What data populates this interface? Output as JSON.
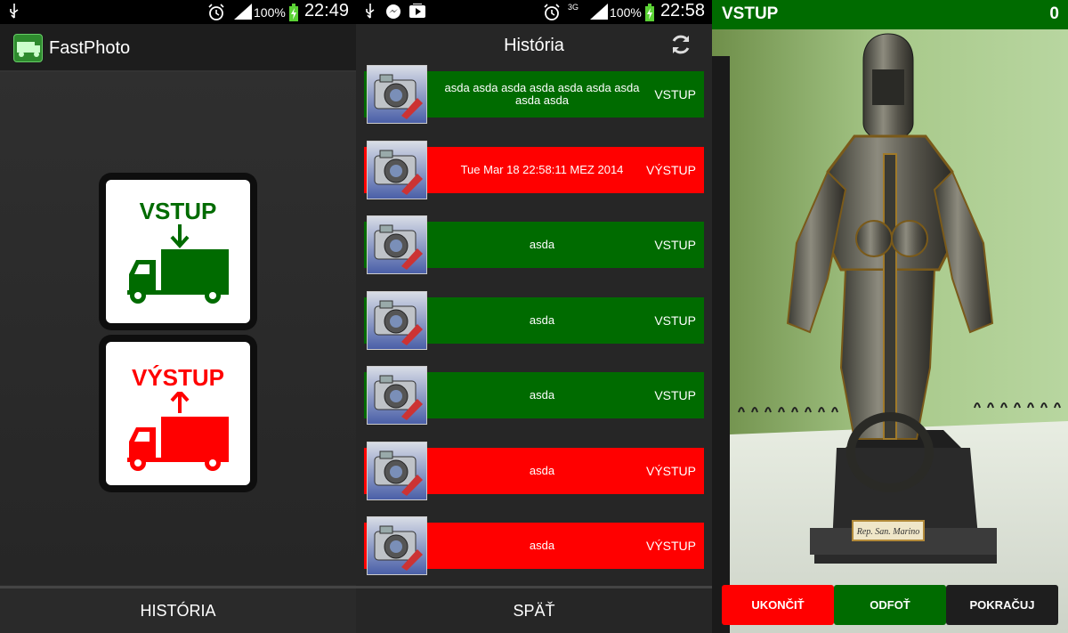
{
  "screen1": {
    "status": {
      "battery_pct": "100%",
      "time": "22:49"
    },
    "app_title": "FastPhoto",
    "vstup_label": "VSTUP",
    "vystup_label": "VÝSTUP",
    "bottom_button": "HISTÓRIA",
    "colors": {
      "green": "#006b00",
      "red": "#ff0000"
    }
  },
  "screen2": {
    "status": {
      "battery_pct": "100%",
      "time": "22:58",
      "network": "3G"
    },
    "title": "História",
    "rows": [
      {
        "text": "asda asda asda asda asda asda asda asda asda",
        "type": "VSTUP",
        "color": "#006b00"
      },
      {
        "text": "Tue Mar 18 22:58:11 MEZ 2014",
        "type": "VÝSTUP",
        "color": "#ff0000"
      },
      {
        "text": "asda",
        "type": "VSTUP",
        "color": "#006b00"
      },
      {
        "text": "asda",
        "type": "VSTUP",
        "color": "#006b00"
      },
      {
        "text": "asda",
        "type": "VSTUP",
        "color": "#006b00"
      },
      {
        "text": "asda",
        "type": "VÝSTUP",
        "color": "#ff0000"
      },
      {
        "text": "asda",
        "type": "VÝSTUP",
        "color": "#ff0000"
      }
    ],
    "bottom_button": "SPÄŤ"
  },
  "screen3": {
    "header_title": "VSTUP",
    "counter": "0",
    "plaque_text": "Rep. San. Marino",
    "buttons": {
      "end": "UKONČIŤ",
      "send": "ODFOŤ",
      "continue": "POKRAČUJ"
    }
  }
}
